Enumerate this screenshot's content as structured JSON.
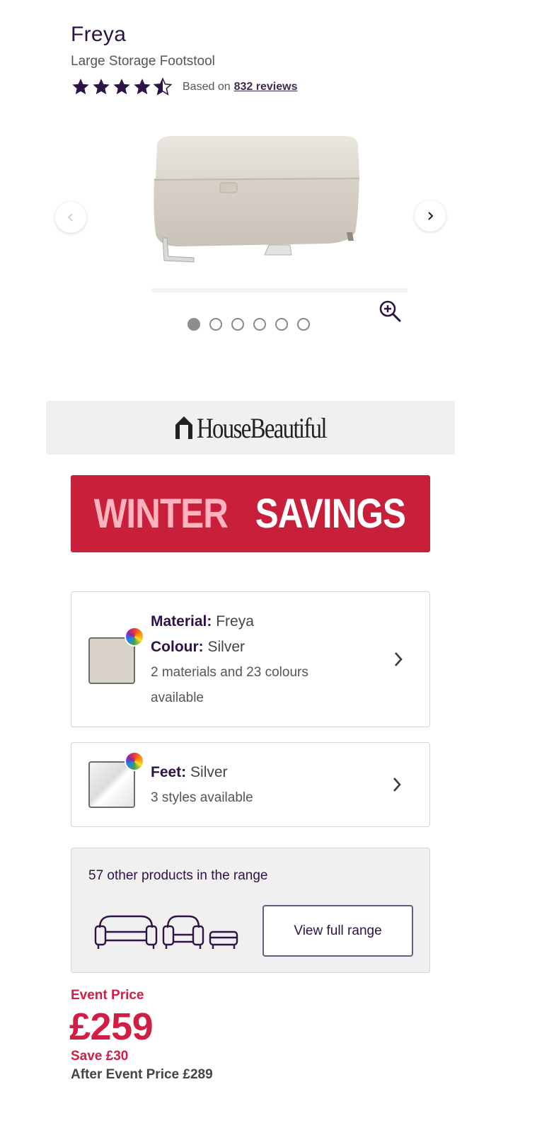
{
  "product": {
    "name": "Freya",
    "subtitle": "Large Storage Footstool",
    "rating": 4.5,
    "review_prefix": "Based on",
    "review_link": "832 reviews"
  },
  "gallery": {
    "image_count": 6,
    "active_index": 0
  },
  "banners": {
    "house_beautiful": "HouseBeautiful",
    "winter_word1": "WINTER",
    "winter_word2": "SAVINGS"
  },
  "options": {
    "material": {
      "material_label": "Material:",
      "material_value": "Freya",
      "colour_label": "Colour:",
      "colour_value": "Silver",
      "availability": "2 materials and 23 colours available"
    },
    "feet": {
      "label": "Feet:",
      "value": "Silver",
      "availability": "3 styles available"
    }
  },
  "range": {
    "text": "57 other products in the range",
    "button": "View full range"
  },
  "pricing": {
    "event_label": "Event Price",
    "price": "£259",
    "save": "Save £30",
    "after": "After Event Price £289"
  },
  "colors": {
    "brand_purple": "#2d1346",
    "sale_red": "#d21e45",
    "banner_red": "#c8203a"
  }
}
